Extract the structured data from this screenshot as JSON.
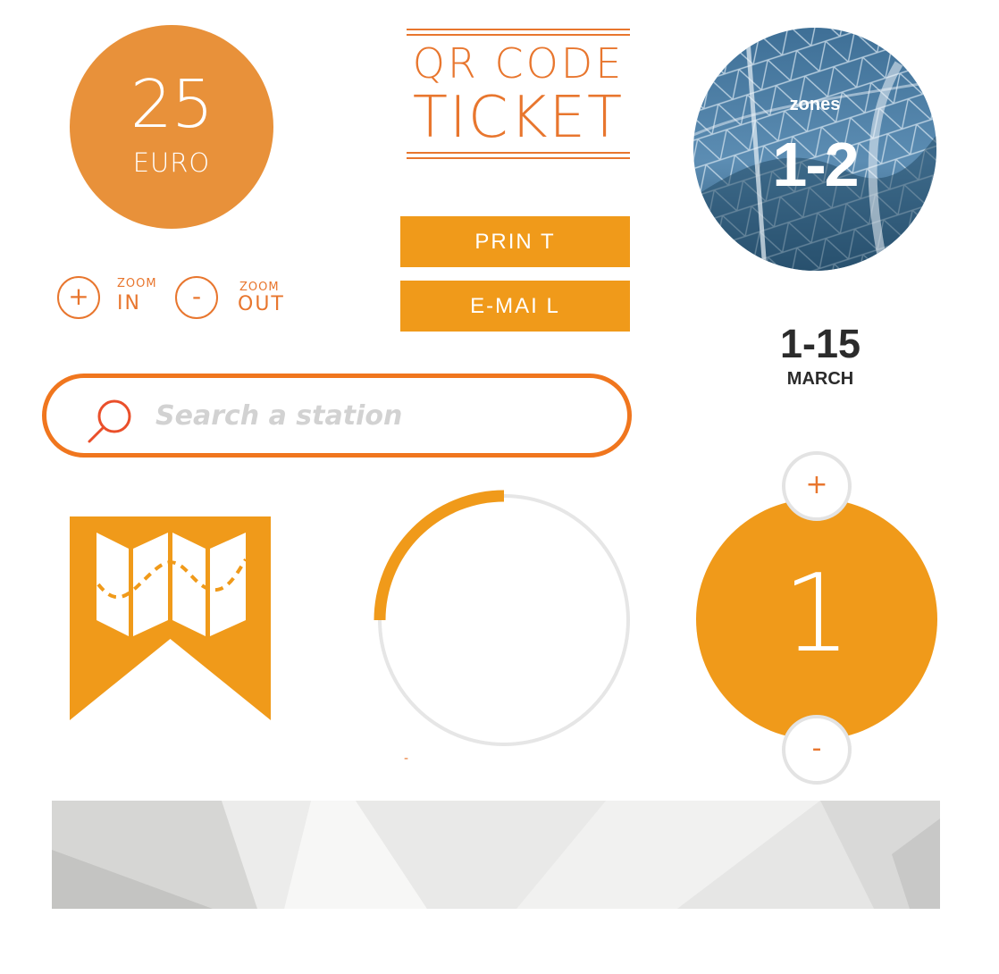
{
  "price": {
    "amount": "25",
    "currency": "EURO"
  },
  "ticket_title": {
    "line1": "QR CODE",
    "line2": "TICKET"
  },
  "zones": {
    "label": "zones",
    "value": "1-2"
  },
  "zoom": {
    "in": {
      "small": "ZOOM",
      "big": "IN",
      "symbol": "+"
    },
    "out": {
      "small": "ZOOM",
      "big": "OUT",
      "symbol": "-"
    }
  },
  "actions": {
    "print_label": "PRIN  T",
    "email_label": "E-MAI  L"
  },
  "date": {
    "range": "1-15",
    "month": "MARCH"
  },
  "search": {
    "placeholder": "Search a station",
    "value": ""
  },
  "progress": {
    "fraction": 0.25,
    "label": "-"
  },
  "counter": {
    "value": "1",
    "plus": "+",
    "minus": "-"
  },
  "icons": {
    "search": "search-icon",
    "map": "map-icon"
  },
  "colors": {
    "orange": "#f09a1a",
    "orange_dark": "#e8762e",
    "price": "#e8913a",
    "track": "#e6e6e6"
  }
}
